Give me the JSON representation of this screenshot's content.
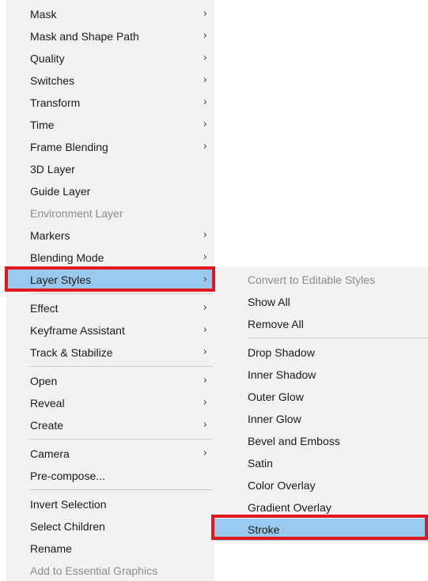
{
  "main_menu": {
    "items": [
      {
        "label": "Mask",
        "arrow": "›"
      },
      {
        "label": "Mask and Shape Path",
        "arrow": "›"
      },
      {
        "label": "Quality",
        "arrow": "›"
      },
      {
        "label": "Switches",
        "arrow": "›"
      },
      {
        "label": "Transform",
        "arrow": "›"
      },
      {
        "label": "Time",
        "arrow": "›"
      },
      {
        "label": "Frame Blending",
        "arrow": "›"
      },
      {
        "label": "3D Layer"
      },
      {
        "label": "Guide Layer"
      },
      {
        "label": "Environment Layer",
        "disabled": true
      },
      {
        "label": "Markers",
        "arrow": "›"
      },
      {
        "label": "Blending Mode",
        "arrow": "›"
      },
      {
        "label": "Layer Styles",
        "arrow": "›",
        "highlighted": true
      },
      {
        "label": "Effect",
        "arrow": "›"
      },
      {
        "label": "Keyframe Assistant",
        "arrow": "›"
      },
      {
        "label": "Track & Stabilize",
        "arrow": "›"
      },
      {
        "label": "Open",
        "arrow": "›"
      },
      {
        "label": "Reveal",
        "arrow": "›"
      },
      {
        "label": "Create",
        "arrow": "›"
      },
      {
        "label": "Camera",
        "arrow": "›"
      },
      {
        "label": "Pre-compose..."
      },
      {
        "label": "Invert Selection"
      },
      {
        "label": "Select Children"
      },
      {
        "label": "Rename"
      },
      {
        "label": "Add to Essential Graphics",
        "disabled": true
      }
    ]
  },
  "sub_menu": {
    "items": [
      {
        "label": "Convert to Editable Styles",
        "disabled": true
      },
      {
        "label": "Show All"
      },
      {
        "label": "Remove All"
      },
      {
        "label": "Drop Shadow"
      },
      {
        "label": "Inner Shadow"
      },
      {
        "label": "Outer Glow"
      },
      {
        "label": "Inner Glow"
      },
      {
        "label": "Bevel and Emboss"
      },
      {
        "label": "Satin"
      },
      {
        "label": "Color Overlay"
      },
      {
        "label": "Gradient Overlay"
      },
      {
        "label": "Stroke",
        "highlighted": true
      }
    ]
  },
  "colors": {
    "menu_background": "#f2f2f2",
    "highlight": "#99c9ef",
    "callout_border": "#e0191f",
    "disabled_text": "#8c8c8c"
  }
}
